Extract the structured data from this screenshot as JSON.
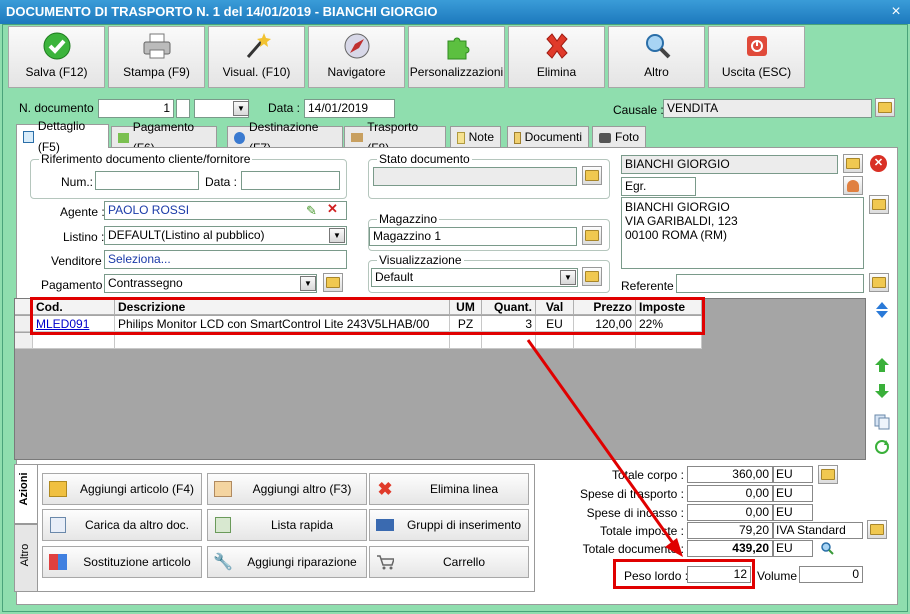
{
  "window": {
    "title": "DOCUMENTO DI TRASPORTO N. 1 del 14/01/2019 - BIANCHI GIORGIO",
    "close": "×"
  },
  "toolbar": {
    "save": "Salva (F12)",
    "print": "Stampa (F9)",
    "preview": "Visual. (F10)",
    "navigator": "Navigatore",
    "custom": "Personalizzazioni",
    "delete": "Elimina",
    "other": "Altro",
    "exit": "Uscita (ESC)"
  },
  "header": {
    "doc_number_label": "N. documento :",
    "doc_number": "1",
    "date_label": "Data :",
    "date": "14/01/2019",
    "causale_label": "Causale :",
    "causale": "VENDITA"
  },
  "tabs": [
    "Dettaglio (F5)",
    "Pagamento (F6)",
    "Destinazione (F7)",
    "Trasporto (F8)",
    "Note",
    "Documenti",
    "Foto"
  ],
  "reference": {
    "group_title": "Riferimento documento cliente/fornitore",
    "num_label": "Num.:",
    "num": "",
    "date_label": "Data :",
    "date": ""
  },
  "fields": {
    "agente_label": "Agente :",
    "agente": "PAOLO ROSSI",
    "listino_label": "Listino :",
    "listino": "DEFAULT(Listino al pubblico)",
    "venditore_label": "Venditore :",
    "venditore": "Seleziona...",
    "pagamento_label": "Pagamento :",
    "pagamento": "Contrassegno"
  },
  "stato": {
    "title": "Stato documento",
    "value": ""
  },
  "magazzino": {
    "title": "Magazzino",
    "value": "Magazzino 1"
  },
  "visualizzazione": {
    "title": "Visualizzazione",
    "value": "Default"
  },
  "customer": {
    "name": "BIANCHI GIORGIO",
    "title": "Egr.",
    "address": [
      "BIANCHI GIORGIO",
      "VIA GARIBALDI, 123",
      "00100 ROMA (RM)"
    ],
    "referente_label": "Referente",
    "referente": ""
  },
  "grid": {
    "headers": [
      "Cod.",
      "Descrizione",
      "UM",
      "Quant.",
      "Val",
      "Prezzo",
      "Imposte"
    ],
    "rows": [
      [
        "MLED091",
        "Philips Monitor LCD con SmartControl Lite 243V5LHAB/00",
        "PZ",
        "3",
        "EU",
        "120,00",
        "22%"
      ]
    ]
  },
  "side_tabs": {
    "azioni": "Azioni",
    "altro": "Altro"
  },
  "actions": {
    "add_article": "Aggiungi articolo (F4)",
    "add_other": "Aggiungi altro (F3)",
    "delete_line": "Elimina linea",
    "load_doc": "Carica da altro doc.",
    "quick_list": "Lista rapida",
    "insert_groups": "Gruppi di inserimento",
    "replace_article": "Sostituzione articolo",
    "add_repair": "Aggiungi riparazione",
    "cart": "Carrello"
  },
  "totals": {
    "corpo_label": "Totale corpo :",
    "corpo": "360,00",
    "corpo_cur": "EU",
    "trasporto_label": "Spese di trasporto :",
    "trasporto": "0,00",
    "trasporto_cur": "EU",
    "incasso_label": "Spese di incasso :",
    "incasso": "0,00",
    "incasso_cur": "EU",
    "imposte_label": "Totale imposte :",
    "imposte": "79,20",
    "imposte_type": "IVA Standard",
    "documento_label": "Totale documento :",
    "documento": "439,20",
    "documento_cur": "EU",
    "peso_label": "Peso lordo :",
    "peso": "12",
    "volume_label": "Volume :",
    "volume": "0"
  },
  "colors": {
    "window_bg": "#8fdeae",
    "titlebar": "#1d79bd",
    "highlight": "#e00000",
    "link": "#0000cc"
  }
}
